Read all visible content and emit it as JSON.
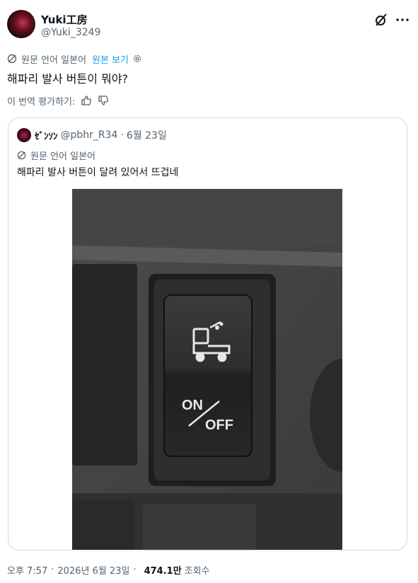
{
  "author": {
    "name": "Yuki工房",
    "handle": "@Yuki_3249"
  },
  "header_icons": [
    "grok-icon",
    "more-icon"
  ],
  "translation": {
    "label": "원문 언어 일본어",
    "show_original": "원본 보기"
  },
  "tweet": {
    "text": "해파리 발사 버튼이 뭐야?"
  },
  "rate_translation": {
    "label": "이 번역 평가하기:"
  },
  "quoted": {
    "name": "ｾﾞﾝｿﾝ",
    "handle": "@pbhr_R34",
    "separator": "·",
    "date": "6월 23일",
    "translation_label": "원문 언어 일본어",
    "text": "해파리 발사 버튼이 달려 있어서 뜨겁네",
    "image": {
      "button_on": "ON",
      "button_off": "OFF"
    }
  },
  "footer": {
    "time": "오후 7:57",
    "separator": "·",
    "date": "2026년 6월 23일",
    "views_count": "474.1만",
    "views_label": "조회수"
  },
  "colors": {
    "accent": "#1d9bf0",
    "secondary_text": "#536471",
    "primary_text": "#0f1419",
    "border": "#cfd9de"
  }
}
